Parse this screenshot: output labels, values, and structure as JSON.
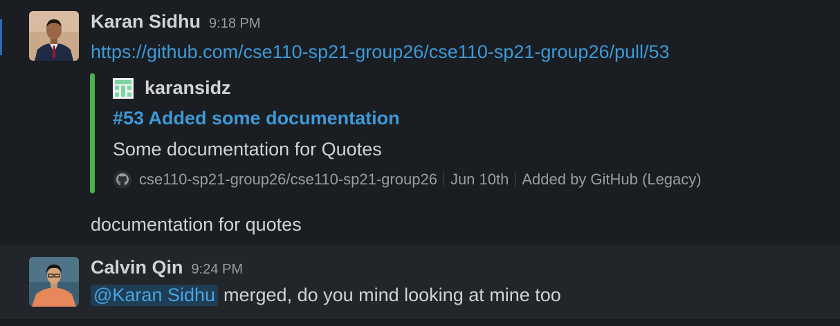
{
  "messages": [
    {
      "author": "Karan Sidhu",
      "time": "9:18 PM",
      "link": "https://github.com/cse110-sp21-group26/cse110-sp21-group26/pull/53",
      "unfurl": {
        "author": "karansidz",
        "title": "#53 Added some documentation",
        "description": "Some documentation for Quotes",
        "repo": "cse110-sp21-group26/cse110-sp21-group26",
        "date": "Jun 10th",
        "added_by": "Added by GitHub (Legacy)",
        "bar_color": "#4caf50"
      },
      "text": "documentation for quotes"
    },
    {
      "author": "Calvin Qin",
      "time": "9:24 PM",
      "mention": "@Karan Sidhu",
      "text": "merged, do you mind looking at mine too"
    }
  ],
  "colors": {
    "background": "#1a1d21",
    "hover_background": "#222529",
    "link": "#3d9ad8",
    "mention_bg": "#1e3e55"
  }
}
